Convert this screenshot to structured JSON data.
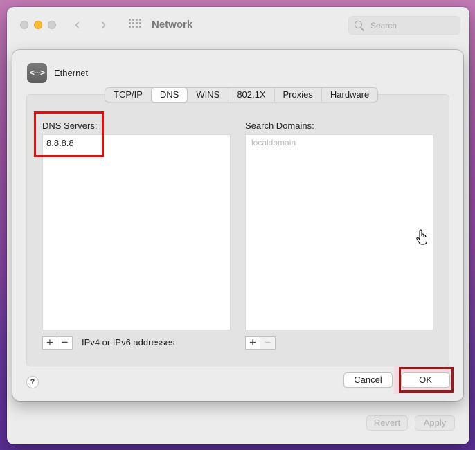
{
  "window": {
    "title": "Network",
    "search_placeholder": "Search",
    "revert_label": "Revert",
    "apply_label": "Apply"
  },
  "sheet": {
    "interface_name": "Ethernet",
    "interface_icon": "<···>",
    "tabs": [
      {
        "label": "TCP/IP",
        "active": false
      },
      {
        "label": "DNS",
        "active": true
      },
      {
        "label": "WINS",
        "active": false
      },
      {
        "label": "802.1X",
        "active": false
      },
      {
        "label": "Proxies",
        "active": false
      },
      {
        "label": "Hardware",
        "active": false
      }
    ],
    "dns": {
      "label": "DNS Servers:",
      "servers": [
        "8.8.8.8"
      ],
      "hint": "IPv4 or IPv6 addresses"
    },
    "search_domains": {
      "label": "Search Domains:",
      "placeholder_entry": "localdomain"
    },
    "plus_label": "+",
    "minus_label": "−",
    "help_label": "?",
    "cancel_label": "Cancel",
    "ok_label": "OK"
  },
  "colors": {
    "annotation_red": "#e01010",
    "annotation_dark_red": "#9b1b1b",
    "traffic_yellow": "#febc2e"
  }
}
